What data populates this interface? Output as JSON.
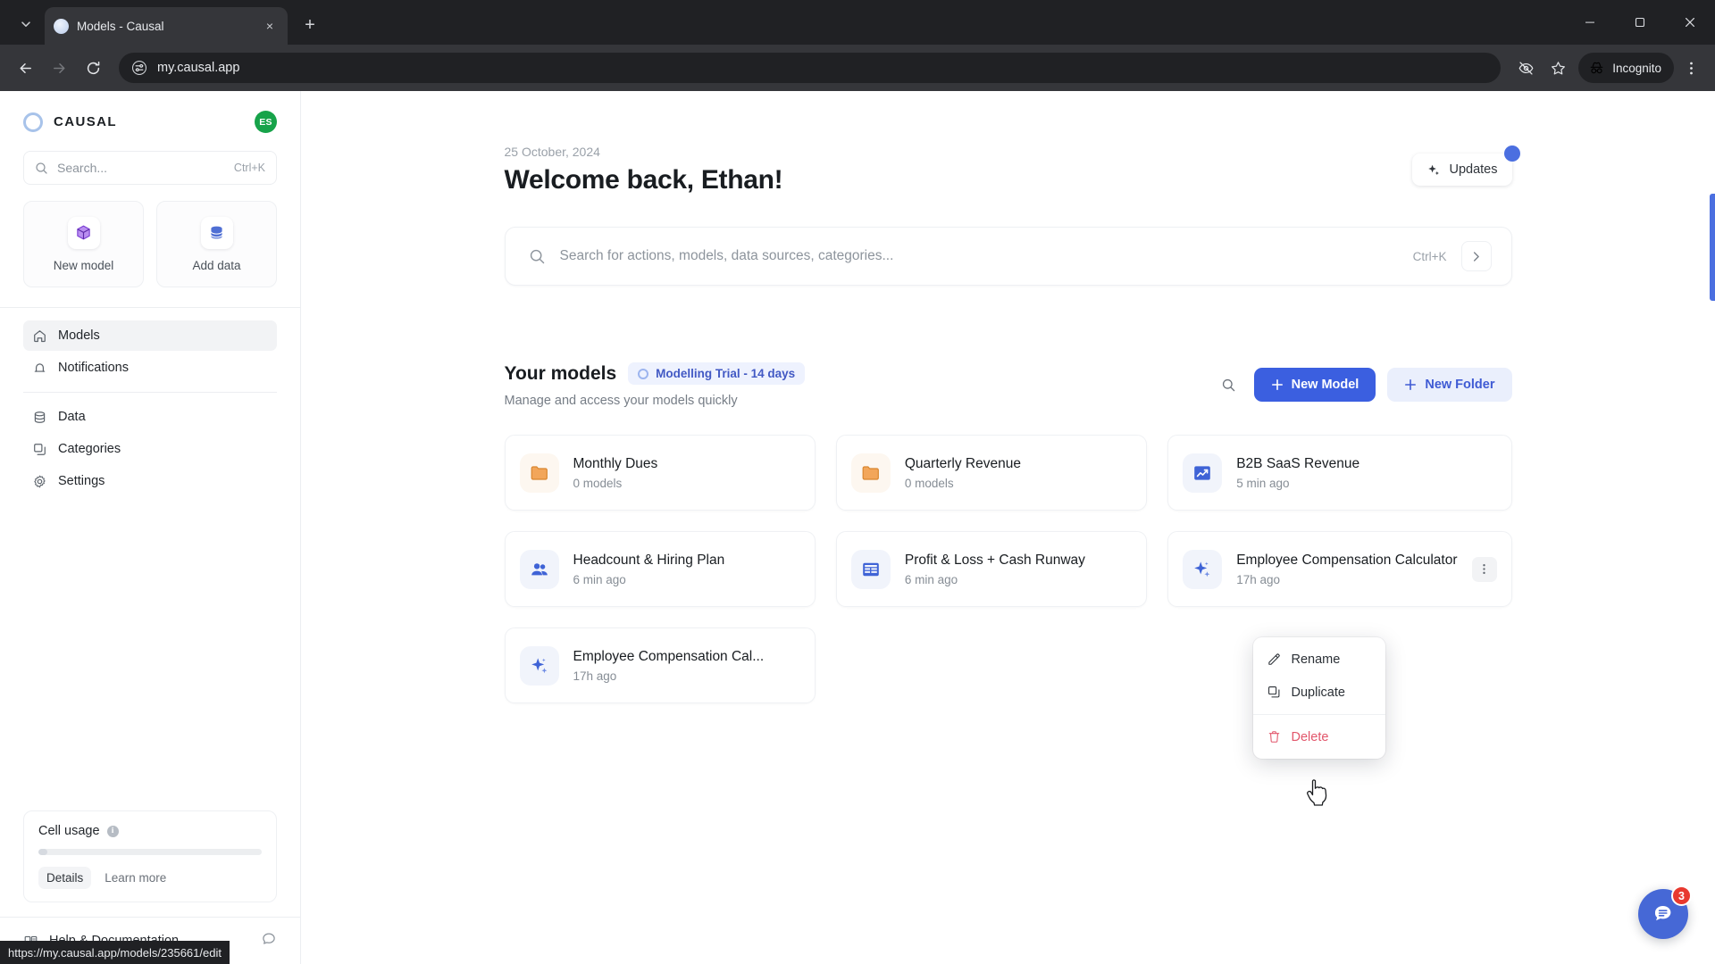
{
  "browser": {
    "tab": {
      "title": "Models - Causal",
      "favicon": "globe-icon",
      "close": "×"
    },
    "new_tab_label": "+",
    "url": "my.causal.app",
    "profile_label": "Incognito",
    "window": {
      "minimize": "—",
      "maximize": "❐",
      "close": "✕"
    },
    "status_url": "https://my.causal.app/models/235661/edit"
  },
  "sidebar": {
    "brand": "CAUSAL",
    "avatar_initials": "ES",
    "search": {
      "placeholder": "Search...",
      "shortcut": "Ctrl+K"
    },
    "quick_actions": [
      {
        "label": "New model",
        "icon": "cube-icon"
      },
      {
        "label": "Add data",
        "icon": "database-icon"
      }
    ],
    "nav_primary": [
      {
        "label": "Models",
        "icon": "home-icon",
        "active": true
      },
      {
        "label": "Notifications",
        "icon": "bell-icon",
        "active": false
      }
    ],
    "nav_secondary": [
      {
        "label": "Data",
        "icon": "database-icon",
        "active": false
      },
      {
        "label": "Categories",
        "icon": "copy-icon",
        "active": false
      },
      {
        "label": "Settings",
        "icon": "gear-icon",
        "active": false
      }
    ],
    "usage": {
      "title": "Cell usage",
      "info_icon": "info-icon",
      "progress_percent": 4,
      "details_label": "Details",
      "learn_more_label": "Learn more"
    },
    "help": {
      "label": "Help & Documentation",
      "icon": "book-icon",
      "chat_icon": "chat-icon"
    }
  },
  "main": {
    "date": "25 October, 2024",
    "greeting": "Welcome back, Ethan!",
    "updates": {
      "label": "Updates",
      "icon": "sparkle-icon",
      "has_notification": true
    },
    "search": {
      "placeholder": "Search for actions, models, data sources, categories...",
      "shortcut": "Ctrl+K"
    },
    "models_section": {
      "title": "Your models",
      "badge": "Modelling Trial - 14 days",
      "subtitle": "Manage and access your models quickly",
      "search_icon": "search-icon",
      "new_model_label": "New Model",
      "new_folder_label": "New Folder"
    },
    "cards": [
      {
        "title": "Monthly Dues",
        "sub": "0 models",
        "icon": "folder-icon",
        "icon_style": "folder",
        "menu": false
      },
      {
        "title": "Quarterly Revenue",
        "sub": "0 models",
        "icon": "folder-icon",
        "icon_style": "folder",
        "menu": false
      },
      {
        "title": "B2B SaaS Revenue",
        "sub": "5 min ago",
        "icon": "chart-icon",
        "icon_style": "blue",
        "menu": false
      },
      {
        "title": "Headcount & Hiring Plan",
        "sub": "6 min ago",
        "icon": "people-icon",
        "icon_style": "blue",
        "menu": false
      },
      {
        "title": "Profit & Loss + Cash Runway",
        "sub": "6 min ago",
        "icon": "spreadsheet-icon",
        "icon_style": "blue",
        "menu": false
      },
      {
        "title": "Employee Compensation Calculator",
        "sub": "17h ago",
        "icon": "sparkle-icon",
        "icon_style": "blue",
        "menu": true
      },
      {
        "title": "Employee Compensation Cal...",
        "sub": "17h ago",
        "icon": "sparkle-icon",
        "icon_style": "blue",
        "menu": false
      }
    ],
    "context_menu": [
      {
        "label": "Rename",
        "icon": "pencil-icon",
        "danger": false
      },
      {
        "label": "Duplicate",
        "icon": "copy-icon",
        "danger": false
      },
      {
        "label": "Delete",
        "icon": "trash-icon",
        "danger": true
      }
    ],
    "chat": {
      "icon": "chat-bubble-icon",
      "badge": "3"
    }
  },
  "colors": {
    "accent": "#3b5fe0",
    "accent_soft": "#eaeffc",
    "danger": "#e2566b",
    "avatar": "#17a34a",
    "badge_red": "#e8392f"
  }
}
